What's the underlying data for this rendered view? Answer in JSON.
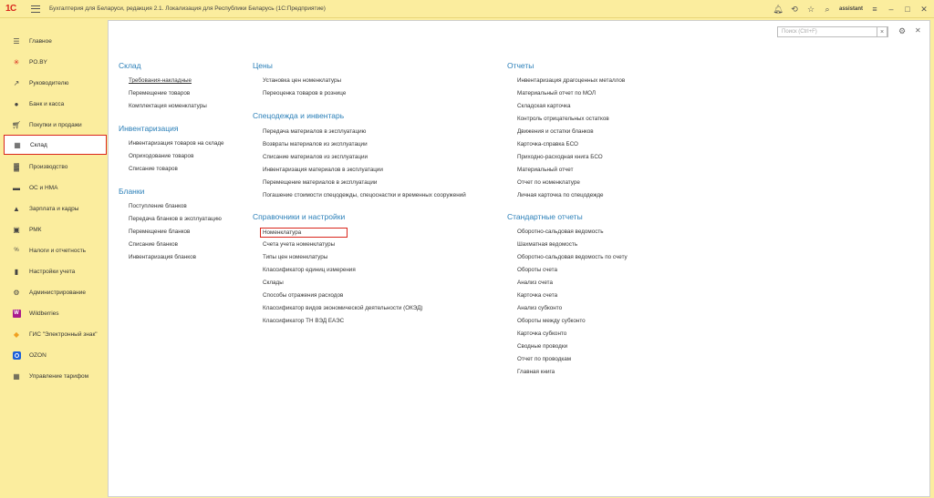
{
  "titlebar": {
    "logo": "1C",
    "title": "Бухгалтерия для Беларуси, редакция 2.1. Локализация для Республики Беларусь  (1С:Предприятие)",
    "user": "assistant"
  },
  "sidebar": {
    "items": [
      {
        "label": "Главное",
        "icon": "menu-lines-icon"
      },
      {
        "label": "PO.BY",
        "icon": "asterisk-icon"
      },
      {
        "label": "Руководителю",
        "icon": "trend-icon"
      },
      {
        "label": "Банк и касса",
        "icon": "coins-icon"
      },
      {
        "label": "Покупки и продажи",
        "icon": "cart-icon"
      },
      {
        "label": "Склад",
        "icon": "warehouse-icon"
      },
      {
        "label": "Производство",
        "icon": "factory-icon"
      },
      {
        "label": "ОС и НМА",
        "icon": "truck-icon"
      },
      {
        "label": "Зарплата и кадры",
        "icon": "person-icon"
      },
      {
        "label": "РМК",
        "icon": "register-icon"
      },
      {
        "label": "Налоги и отчетность",
        "icon": "percent-icon"
      },
      {
        "label": "Настройки учета",
        "icon": "book-icon"
      },
      {
        "label": "Администрирование",
        "icon": "gear-icon"
      },
      {
        "label": "Wildberries",
        "icon": "wildberries-icon"
      },
      {
        "label": "ГИС \"Электронный знак\"",
        "icon": "diamond-icon"
      },
      {
        "label": "OZON",
        "icon": "ozon-icon"
      },
      {
        "label": "Управление тарифом",
        "icon": "grid-icon"
      }
    ]
  },
  "search": {
    "placeholder": "Поиск (Ctrl+F)",
    "clear": "×"
  },
  "sections": {
    "sklad": {
      "title": "Склад",
      "links": [
        "Требования-накладные",
        "Перемещение товаров",
        "Комплектация номенклатуры"
      ]
    },
    "inventarizaciya": {
      "title": "Инвентаризация",
      "links": [
        "Инвентаризация товаров на складе",
        "Оприходование товаров",
        "Списание товаров"
      ]
    },
    "blanki": {
      "title": "Бланки",
      "links": [
        "Поступление бланков",
        "Передача бланков в эксплуатацию",
        "Перемещение бланков",
        "Списание бланков",
        "Инвентаризация бланков"
      ]
    },
    "ceny": {
      "title": "Цены",
      "links": [
        "Установка цен номенклатуры",
        "Переоценка товаров в рознице"
      ]
    },
    "specodezhda": {
      "title": "Спецодежда и инвентарь",
      "links": [
        "Передача материалов в эксплуатацию",
        "Возвраты материалов из эксплуатации",
        "Списание материалов из эксплуатации",
        "Инвентаризация материалов в эксплуатации",
        "Перемещение материалов в эксплуатации",
        "Погашение стоимости спецодежды, спецоснастки и временных сооружений"
      ]
    },
    "spravochniki": {
      "title": "Справочники и настройки",
      "links": [
        "Номенклатура",
        "Счета учета номенклатуры",
        "Типы цен номенклатуры",
        "Классификатор единиц измерения",
        "Склады",
        "Способы отражения расходов",
        "Классификатор видов экономической деятельности (ОКЭД)",
        "Классификатор ТН ВЭД ЕАЭС"
      ]
    },
    "otchety": {
      "title": "Отчеты",
      "links": [
        "Инвентаризация драгоценных металлов",
        "Материальный отчет по МОЛ",
        "Складская карточка",
        "Контроль отрицательных остатков",
        "Движения и остатки бланков",
        "Карточка-справка БСО",
        "Приходно-расходная книга БСО",
        "Материальный отчет",
        "Отчет по номенклатуре",
        "Личная карточка по спецодежде"
      ]
    },
    "standard": {
      "title": "Стандартные отчеты",
      "links": [
        "Оборотно-сальдовая ведомость",
        "Шахматная ведомость",
        "Оборотно-сальдовая ведомость по счету",
        "Обороты счета",
        "Анализ счета",
        "Карточка счета",
        "Анализ субконто",
        "Обороты между субконто",
        "Карточка субконто",
        "Сводные проводки",
        "Отчет по проводкам",
        "Главная книга"
      ]
    }
  },
  "colors": {
    "accent_red": "#d9261c",
    "section_blue": "#2a7fb8",
    "sidebar_bg": "#fbed9e"
  }
}
